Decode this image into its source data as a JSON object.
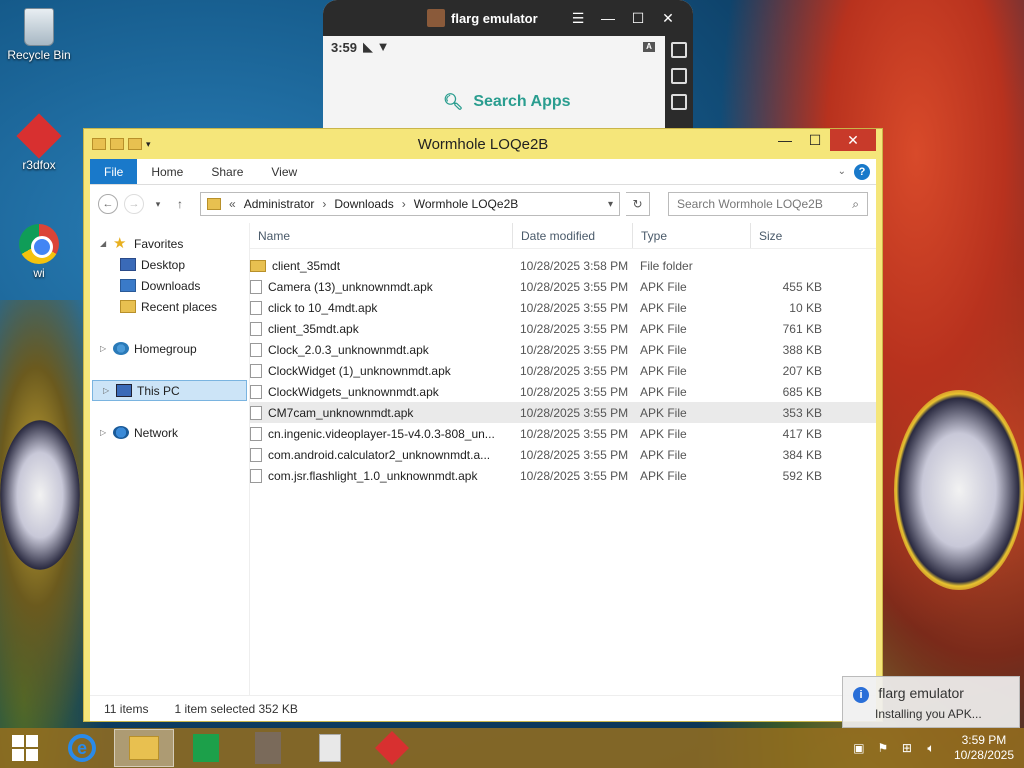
{
  "desktop": {
    "icons": [
      {
        "label": "Recycle Bin",
        "icon": "recycle-bin-icon"
      },
      {
        "label": "r3dfox",
        "icon": "r3dfox-icon"
      },
      {
        "label": "wi",
        "icon": "chrome-icon"
      }
    ]
  },
  "emulator": {
    "title": "flarg emulator",
    "time": "3:59",
    "search_label": "Search Apps",
    "controls": {
      "menu": "☰",
      "minimize": "—",
      "maximize": "☐",
      "close": "✕"
    }
  },
  "explorer": {
    "title": "Wormhole LOQe2B",
    "controls": {
      "minimize": "—",
      "maximize": "☐",
      "close": "✕"
    },
    "ribbon_tabs": [
      "File",
      "Home",
      "Share",
      "View"
    ],
    "address": {
      "prefix": "«",
      "crumbs": [
        "Administrator",
        "Downloads",
        "Wormhole LOQe2B"
      ]
    },
    "search_placeholder": "Search Wormhole LOQe2B",
    "nav": {
      "favorites": "Favorites",
      "desktop": "Desktop",
      "downloads": "Downloads",
      "recent": "Recent places",
      "homegroup": "Homegroup",
      "thispc": "This PC",
      "network": "Network"
    },
    "columns": {
      "name": "Name",
      "date": "Date modified",
      "type": "Type",
      "size": "Size"
    },
    "files": [
      {
        "name": "client_35mdt",
        "date": "10/28/2025 3:58 PM",
        "type": "File folder",
        "size": "",
        "folder": true
      },
      {
        "name": "Camera (13)_unknownmdt.apk",
        "date": "10/28/2025 3:55 PM",
        "type": "APK File",
        "size": "455 KB"
      },
      {
        "name": "click to 10_4mdt.apk",
        "date": "10/28/2025 3:55 PM",
        "type": "APK File",
        "size": "10 KB"
      },
      {
        "name": "client_35mdt.apk",
        "date": "10/28/2025 3:55 PM",
        "type": "APK File",
        "size": "761 KB"
      },
      {
        "name": "Clock_2.0.3_unknownmdt.apk",
        "date": "10/28/2025 3:55 PM",
        "type": "APK File",
        "size": "388 KB"
      },
      {
        "name": "ClockWidget (1)_unknownmdt.apk",
        "date": "10/28/2025 3:55 PM",
        "type": "APK File",
        "size": "207 KB"
      },
      {
        "name": "ClockWidgets_unknownmdt.apk",
        "date": "10/28/2025 3:55 PM",
        "type": "APK File",
        "size": "685 KB"
      },
      {
        "name": "CM7cam_unknownmdt.apk",
        "date": "10/28/2025 3:55 PM",
        "type": "APK File",
        "size": "353 KB",
        "selected": true
      },
      {
        "name": "cn.ingenic.videoplayer-15-v4.0.3-808_un...",
        "date": "10/28/2025 3:55 PM",
        "type": "APK File",
        "size": "417 KB"
      },
      {
        "name": "com.android.calculator2_unknownmdt.a...",
        "date": "10/28/2025 3:55 PM",
        "type": "APK File",
        "size": "384 KB"
      },
      {
        "name": "com.jsr.flashlight_1.0_unknownmdt.apk",
        "date": "10/28/2025 3:55 PM",
        "type": "APK File",
        "size": "592 KB"
      }
    ],
    "status": {
      "count": "11 items",
      "selection": "1 item selected  352 KB"
    }
  },
  "toast": {
    "title": "flarg emulator",
    "message": "Installing you APK..."
  },
  "taskbar": {
    "time": "3:59 PM",
    "date": "10/28/2025"
  },
  "colors": {
    "title_bar": "#f5e67a",
    "accent": "#1979ca",
    "close": "#c83a2a",
    "taskbar": "#96701e"
  }
}
